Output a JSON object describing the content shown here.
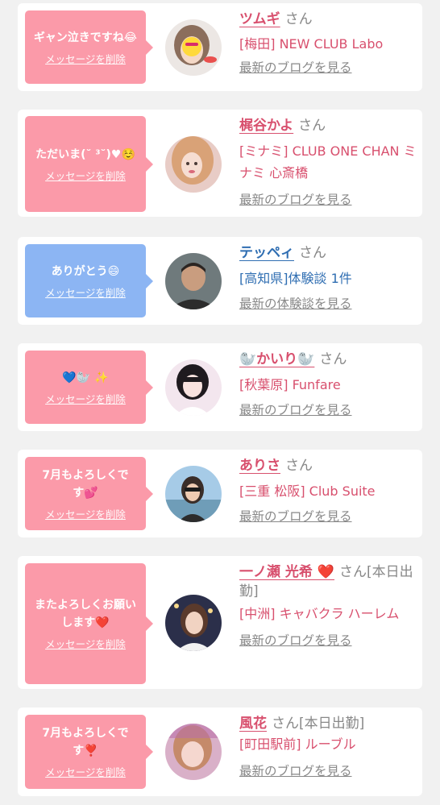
{
  "delete_label": "メッセージを削除",
  "colors": {
    "pink_bubble": "#fb9aa9",
    "blue_bubble": "#8cb5f3",
    "pink_text": "#d8506e",
    "blue_text": "#2f6eb2"
  },
  "cards": [
    {
      "message": "ギャン泣きですね😂",
      "name": "ツムギ",
      "san": "さん",
      "shop": "[梅田] NEW CLUB Labo",
      "link": "最新のブログを見る"
    },
    {
      "message": "ただいま(˘ ³˘)♥☺️",
      "name": "梶谷かよ",
      "san": "さん",
      "shop": "[ミナミ] CLUB ONE CHAN ミナミ 心斎橋",
      "link": "最新のブログを見る"
    },
    {
      "message": "ありがとう😄",
      "name": "テッペィ",
      "san": "さん",
      "shop": "[高知県]体験談 1件",
      "link": "最新の体験談を見る"
    },
    {
      "message": "💙🦭 ✨",
      "name": "🦭かいり🦭",
      "san": "さん",
      "shop": "[秋葉原] Funfare",
      "link": "最新のブログを見る"
    },
    {
      "message": "7月もよろしくです💕",
      "name": "ありさ",
      "san": "さん",
      "shop": "[三重 松阪] Club Suite",
      "link": "最新のブログを見る"
    },
    {
      "message": "またよろしくお願いします❤️",
      "name": "一ノ瀬 光希 ❤️",
      "san": "さん[本日出勤]",
      "shop": "[中洲] キャバクラ ハーレム",
      "link": "最新のブログを見る"
    },
    {
      "message": "7月もよろしくです❣️",
      "name": "風花",
      "san": "さん[本日出勤]",
      "shop": "[町田駅前] ルーブル",
      "link": "最新のブログを見る"
    }
  ]
}
